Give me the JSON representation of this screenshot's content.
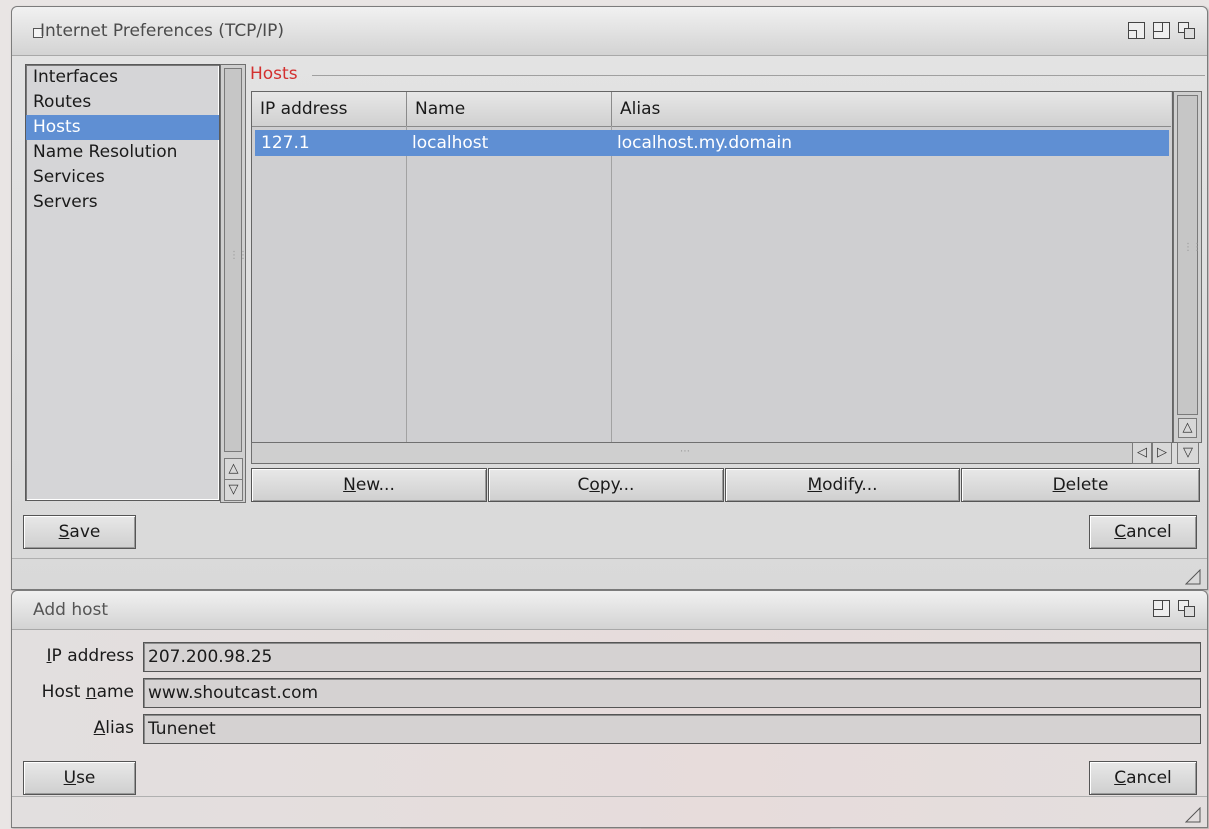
{
  "prefs_window": {
    "title": "Internet Preferences (TCP/IP)",
    "categories": [
      {
        "label": "Interfaces",
        "selected": false
      },
      {
        "label": "Routes",
        "selected": false
      },
      {
        "label": "Hosts",
        "selected": true
      },
      {
        "label": "Name Resolution",
        "selected": false
      },
      {
        "label": "Services",
        "selected": false
      },
      {
        "label": "Servers",
        "selected": false
      }
    ],
    "group_label": "Hosts",
    "table": {
      "columns": [
        "IP address",
        "Name",
        "Alias"
      ],
      "rows": [
        {
          "ip": "127.1",
          "name": "localhost",
          "alias": "localhost.my.domain",
          "selected": true
        }
      ]
    },
    "buttons": {
      "new": {
        "hotkey": "N",
        "rest": "ew..."
      },
      "copy": {
        "pre": "C",
        "hotkey": "o",
        "rest": "py..."
      },
      "modify": {
        "hotkey": "M",
        "rest": "odify..."
      },
      "delete": {
        "hotkey": "D",
        "rest": "elete"
      },
      "save": {
        "hotkey": "S",
        "rest": "ave"
      },
      "cancel": {
        "hotkey": "C",
        "rest": "ancel"
      }
    }
  },
  "add_host_window": {
    "title": "Add host",
    "fields": {
      "ip": {
        "label_hotkey": "I",
        "label_rest": "P address",
        "value": "207.200.98.25"
      },
      "hostname": {
        "label_pre": "Host ",
        "label_hotkey": "n",
        "label_rest": "ame",
        "value": "www.shoutcast.com"
      },
      "alias": {
        "label_hotkey": "A",
        "label_rest": "lias",
        "value": "Tunenet"
      }
    },
    "buttons": {
      "use": {
        "hotkey": "U",
        "rest": "se"
      },
      "cancel": {
        "hotkey": "C",
        "rest": "ancel"
      }
    }
  },
  "icons": [
    "close-icon",
    "zoom-icon",
    "iconify-icon",
    "depth-icon",
    "arrow-up-icon",
    "arrow-down-icon",
    "arrow-left-icon",
    "arrow-right-icon",
    "resize-icon"
  ],
  "colors": {
    "selection": "#5f8fd3",
    "group_label": "#d3302f"
  }
}
